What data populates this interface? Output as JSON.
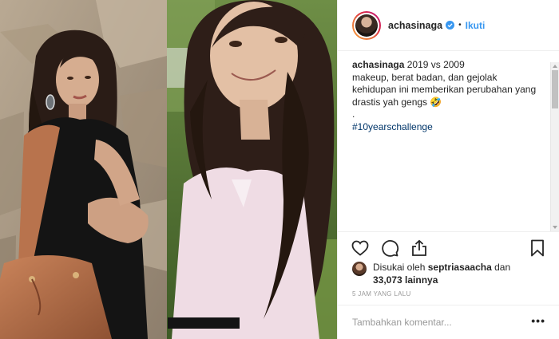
{
  "post": {
    "username": "achasinaga",
    "follow_label": "Ikuti",
    "separator": "•",
    "caption": {
      "username": "achasinaga",
      "line1": "2019 vs 2009",
      "line2": "makeup, berat badan, dan gejolak",
      "line3": "kehidupan ini memberikan perubahan yang",
      "line4": "drastis yah gengs",
      "emoji": "🤣",
      "line5": ".",
      "hashtag": "#10yearschallenge"
    },
    "likes": {
      "prefix": "Disukai oleh",
      "liker": "septriasaacha",
      "conj": "dan",
      "count": "33,073",
      "suffix": "lainnya"
    },
    "time": "5 JAM YANG LALU",
    "comment_placeholder": "Tambahkan komentar...",
    "more_label": "•••"
  },
  "colors": {
    "link_blue": "#3897f0",
    "hashtag_blue": "#003569",
    "text": "#262626",
    "muted": "#999999"
  },
  "icons": [
    "verified-badge-icon",
    "heart-icon",
    "comment-icon",
    "share-icon",
    "bookmark-icon",
    "more-options-icon"
  ]
}
